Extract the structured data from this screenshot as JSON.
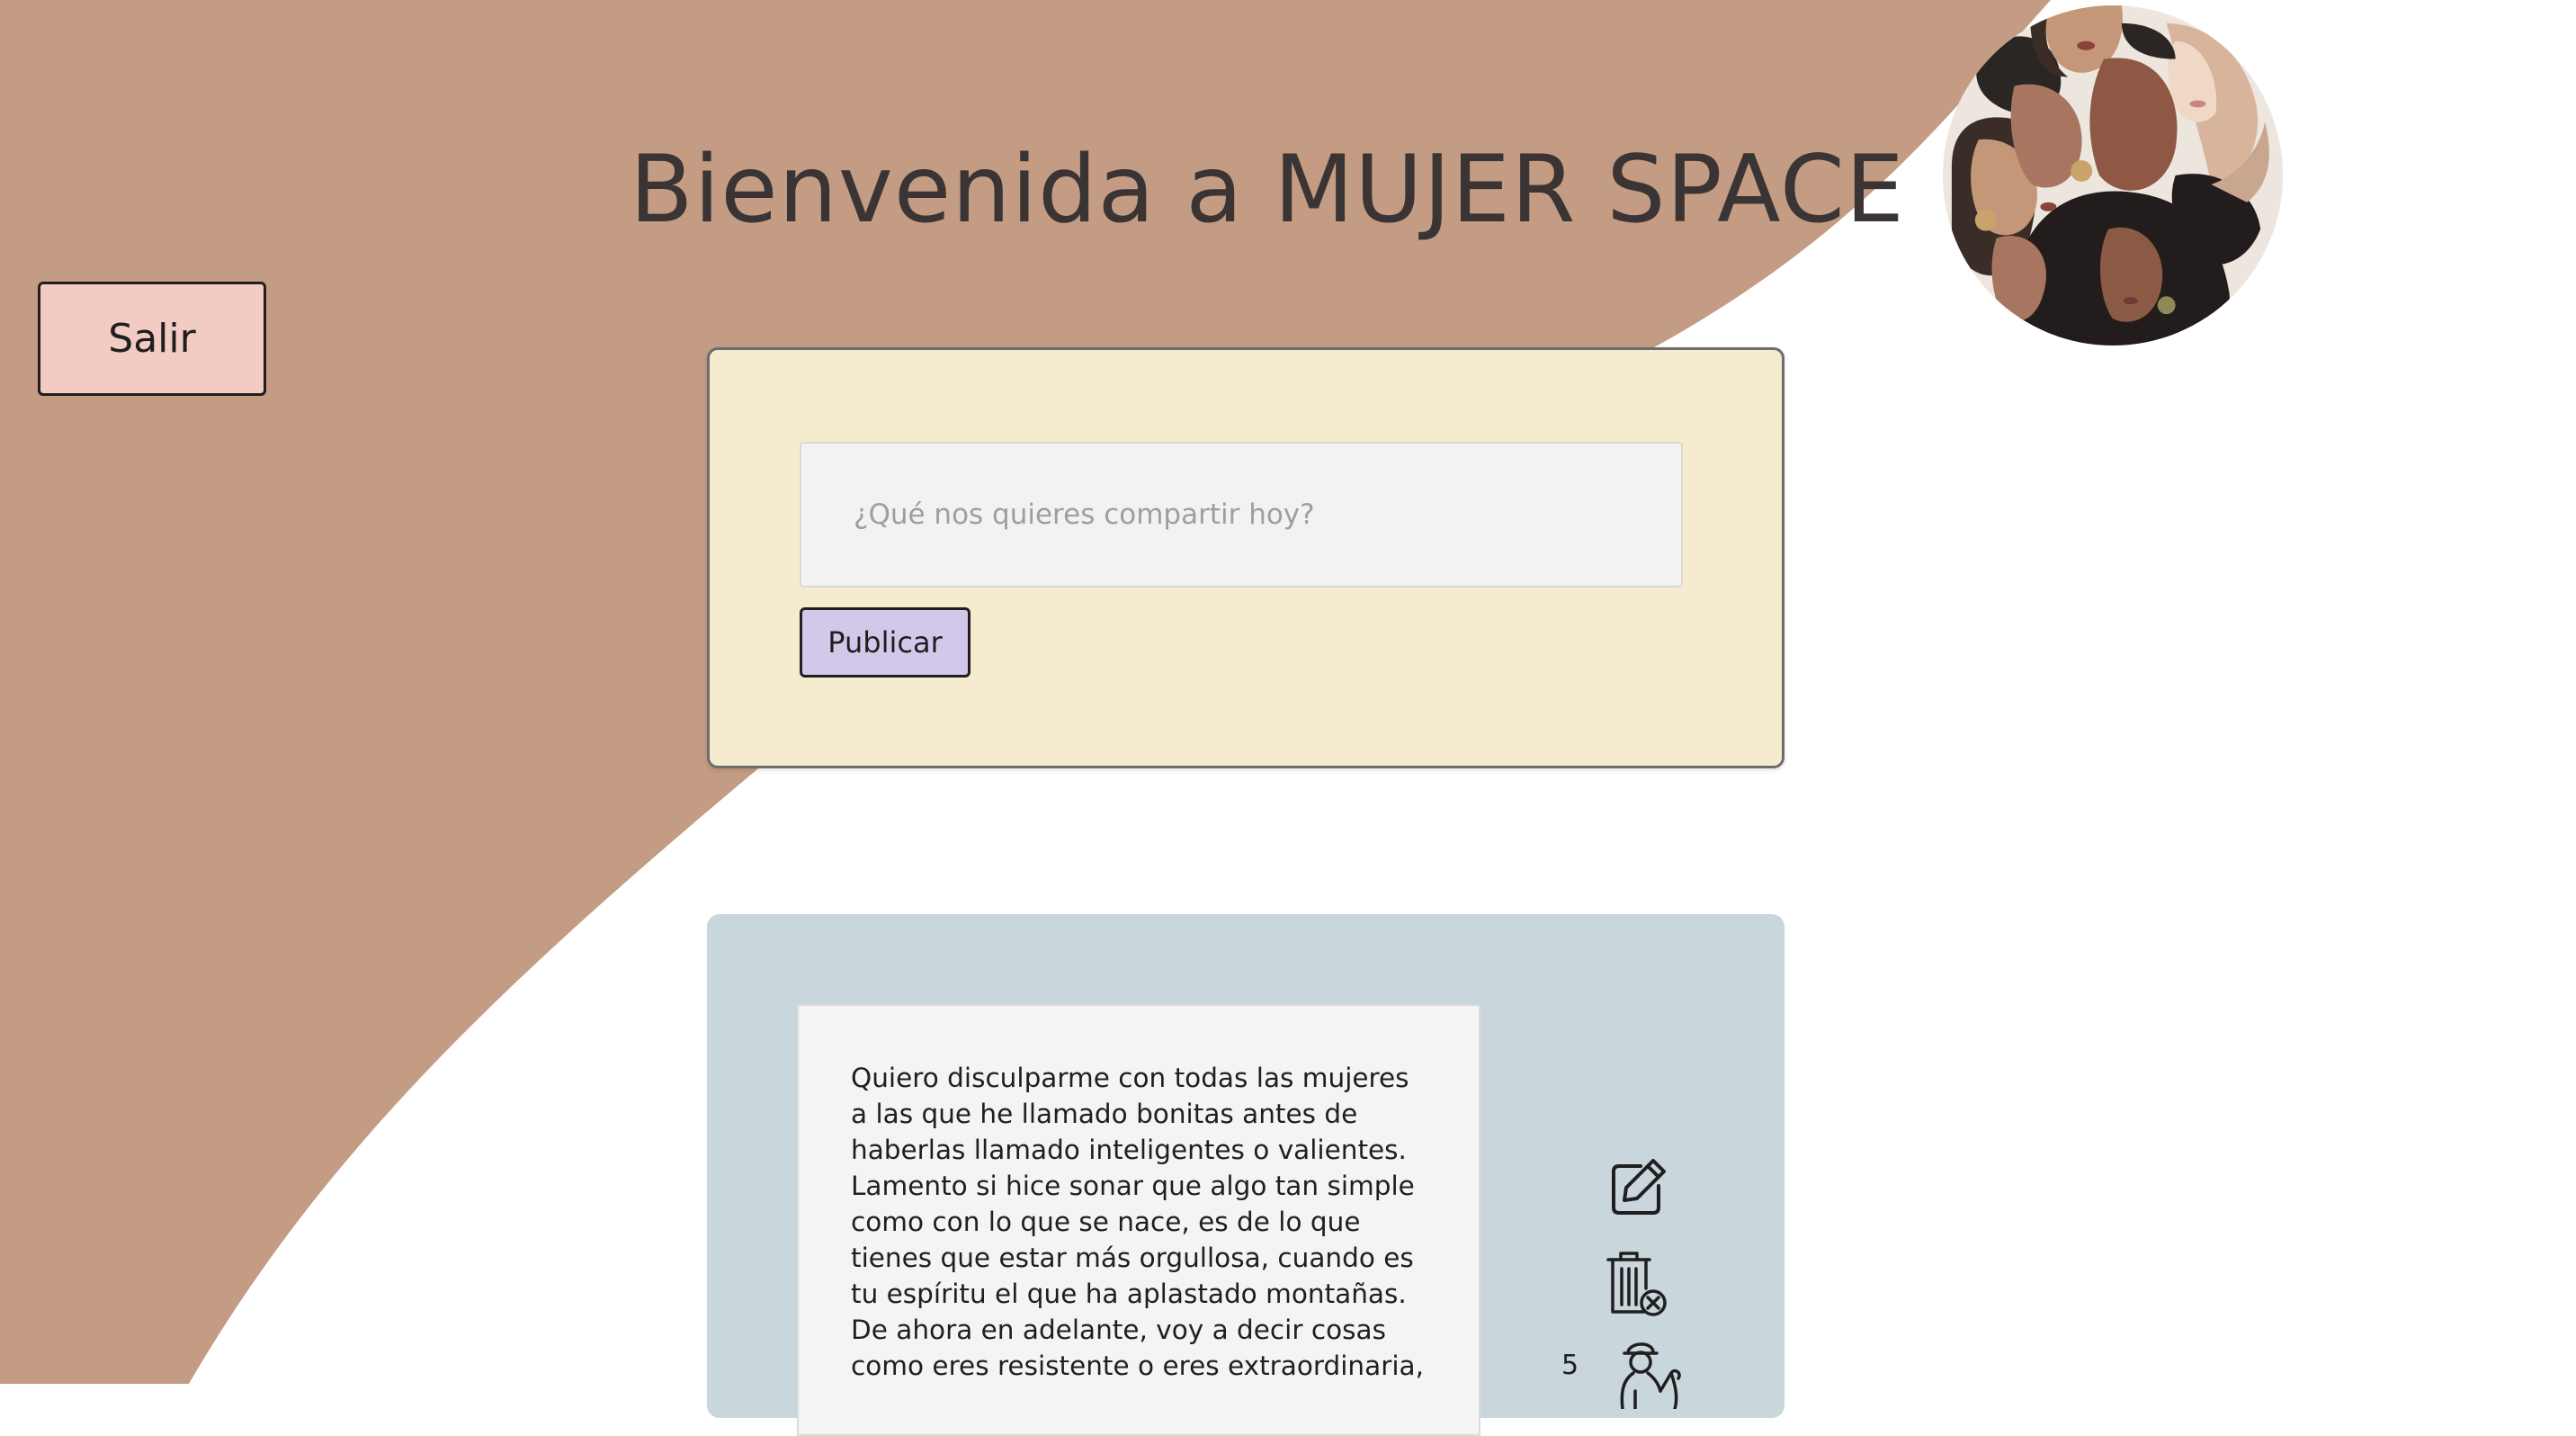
{
  "header": {
    "title": "Bienvenida a MUJER SPACE"
  },
  "nav": {
    "logout_label": "Salir"
  },
  "compose": {
    "placeholder": "¿Qué nos quieres compartir hoy?",
    "value": "",
    "publish_label": "Publicar"
  },
  "posts": [
    {
      "text": "Quiero disculparme con todas las mujeres a las que he llamado bonitas antes de haberlas llamado inteligentes o valientes. Lamento si hice sonar que algo tan simple como con lo que se nace, es de lo que tienes que estar más orgullosa, cuando es tu espíritu el que ha aplastado montañas. De ahora en adelante, voy a decir cosas como eres resistente o eres extraordinaria,",
      "likes": "5",
      "icons": [
        "edit-icon",
        "trash-icon",
        "woman-like-icon"
      ]
    }
  ],
  "colors": {
    "background_shape": "#c49c84",
    "page_background": "#ffffff",
    "logout_button": "#f2cbc3",
    "compose_card": "#f5ecd0",
    "publish_button": "#d2c9ea",
    "post_card": "#c9d6db",
    "text_dark": "#3a3534"
  }
}
